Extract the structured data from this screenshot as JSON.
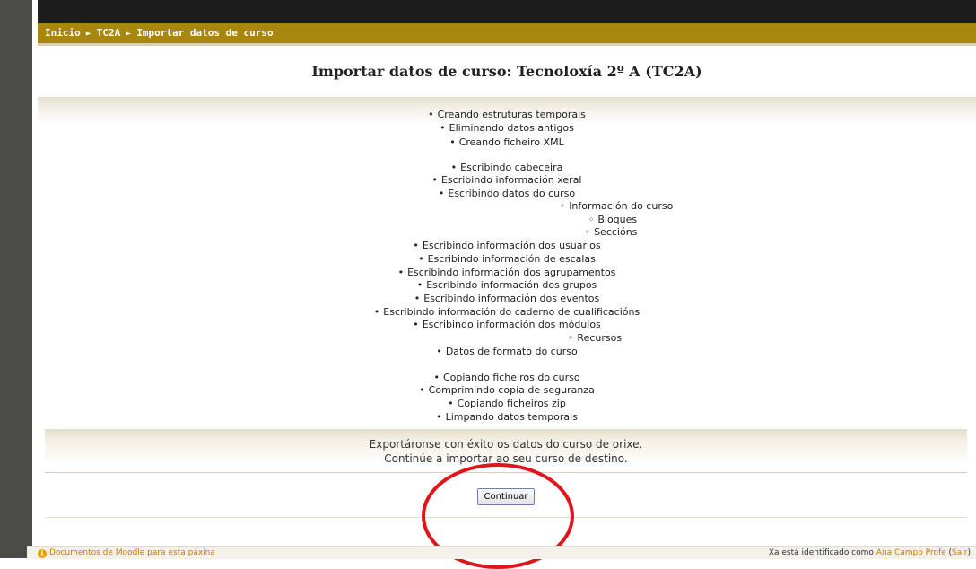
{
  "breadcrumb": {
    "home": "Inicio",
    "separator": "►",
    "course": "TC2A",
    "current": "Importar datos de curso"
  },
  "page_title": "Importar datos de curso: Tecnoloxía 2º A (TC2A)",
  "log_items": [
    {
      "bullet": "•",
      "text": "Creando estruturas temporais"
    },
    {
      "bullet": "•",
      "text": "Eliminando datos antigos"
    },
    {
      "bullet": "•",
      "text": "Creando ficheiro XML"
    },
    {
      "bullet": "•",
      "text": "Escribindo cabeceira"
    },
    {
      "bullet": "•",
      "text": "Escribindo información xeral"
    },
    {
      "bullet": "•",
      "text": "Escribindo datos do curso"
    },
    {
      "bullet": "◦",
      "text": "Información do curso"
    },
    {
      "bullet": "◦",
      "text": "Bloques"
    },
    {
      "bullet": "◦",
      "text": "Seccións"
    },
    {
      "bullet": "•",
      "text": "Escribindo información dos usuarios"
    },
    {
      "bullet": "•",
      "text": "Escribindo información de escalas"
    },
    {
      "bullet": "•",
      "text": "Escribindo información dos agrupamentos"
    },
    {
      "bullet": "•",
      "text": "Escribindo información dos grupos"
    },
    {
      "bullet": "•",
      "text": "Escribindo información dos eventos"
    },
    {
      "bullet": "•",
      "text": "Escribindo información do caderno de cualificacións"
    },
    {
      "bullet": "•",
      "text": "Escribindo información dos módulos"
    },
    {
      "bullet": "◦",
      "text": "Recursos"
    },
    {
      "bullet": "•",
      "text": "Datos de formato do curso"
    },
    {
      "bullet": "•",
      "text": "Copiando ficheiros do curso"
    },
    {
      "bullet": "•",
      "text": "Comprimindo copia de seguranza"
    },
    {
      "bullet": "•",
      "text": "Copiando ficheiros zip"
    },
    {
      "bullet": "•",
      "text": "Limpando datos temporais"
    }
  ],
  "result": {
    "line1": "Exportáronse con éxito os datos do curso de orixe.",
    "line2": "Continúe a importar ao seu curso de destino."
  },
  "continue_label": "Continuar",
  "footer": {
    "docs_icon": "i",
    "docs_link": "Documentos de Moodle para esta páxina",
    "logged_prefix": "Xa está identificado como",
    "user_name": "Ana Campo Profe",
    "logout_label": "Sair"
  },
  "colors": {
    "nav_bar": "#a8860f",
    "highlight_circle": "#e0141b",
    "link": "#c77c00"
  }
}
